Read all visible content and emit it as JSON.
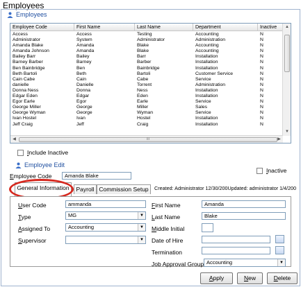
{
  "window": {
    "title": "Employees"
  },
  "employees_section": {
    "title": "Employees"
  },
  "grid": {
    "columns": [
      "Employee Code",
      "First Name",
      "Last Name",
      "Department",
      "Inactive"
    ],
    "rows": [
      [
        "Access",
        "Access",
        "Testing",
        "Accounting",
        "N"
      ],
      [
        "Administrator",
        "System",
        "Administrator",
        "Administration",
        "N"
      ],
      [
        "Amanda Blake",
        "Amanda",
        "Blake",
        "Accounting",
        "N"
      ],
      [
        "Amanda Johnson",
        "Amanda",
        "Blake",
        "Accounting",
        "N"
      ],
      [
        "Bailey Barr",
        "Bailey",
        "Barr",
        "Installation",
        "N"
      ],
      [
        "Barney Barber",
        "Barney",
        "Barber",
        "Installation",
        "N"
      ],
      [
        "Ben Bainbridge",
        "Ben",
        "Bainbridge",
        "Installation",
        "N"
      ],
      [
        "Beth Bartoli",
        "Beth",
        "Bartoli",
        "Customer Service",
        "N"
      ],
      [
        "Cain Cabe",
        "Cain",
        "Cabe",
        "Service",
        "N"
      ],
      [
        "danielle",
        "Danielle",
        "Torrent",
        "Administration",
        "N"
      ],
      [
        "Donna Ness",
        "Donna",
        "Ness",
        "Installation",
        "N"
      ],
      [
        "Edgar Eden",
        "Edgar",
        "Eden",
        "Installation",
        "N"
      ],
      [
        "Egor Earle",
        "Egor",
        "Earle",
        "Service",
        "N"
      ],
      [
        "George Miller",
        "George",
        "Miller",
        "Sales",
        "N"
      ],
      [
        "George Wyman",
        "George",
        "Wyman",
        "Service",
        "N"
      ],
      [
        "Ivan Hostel",
        "Ivan",
        "Hostel",
        "Installation",
        "N"
      ],
      [
        "Jeff Craig",
        "Jeff",
        "Craig",
        "Installation",
        "N"
      ]
    ]
  },
  "include_inactive": {
    "label": "Include Inactive",
    "checked": false
  },
  "employee_edit": {
    "title": "Employee Edit",
    "employee_code_label": "Employee Code",
    "employee_code_value": "Amanda Blake",
    "inactive_label": "Inactive",
    "inactive_checked": false
  },
  "tabs": [
    {
      "label": "General Information",
      "active": true
    },
    {
      "label": "Payroll",
      "active": false
    },
    {
      "label": "Commission Setup",
      "active": false
    }
  ],
  "audit_text": "Created: Administrator 12/30/200Updated: administrator 1/4/200",
  "form": {
    "user_code_label": "User Code",
    "user_code_value": "ammanda",
    "type_label": "Type",
    "type_value": "MG",
    "assigned_to_label": "Assigned To",
    "assigned_to_value": "Accounting",
    "supervisor_label": "Supervisor",
    "supervisor_value": "",
    "first_name_label": "First Name",
    "first_name_value": "Amanda",
    "last_name_label": "Last Name",
    "last_name_value": "Blake",
    "middle_initial_label": "Middle Initial",
    "middle_initial_value": "",
    "date_of_hire_label": "Date of Hire",
    "date_of_hire_value": "",
    "termination_label": "Termination",
    "termination_value": "",
    "job_approval_group_label": "Job Approval Group",
    "job_approval_group_value": "Accounting"
  },
  "buttons": {
    "apply": "Apply",
    "new": "New",
    "delete": "Delete"
  },
  "icons": {
    "section": "people-icon",
    "scroll_up": "▲",
    "scroll_down": "▼",
    "scroll_left": "◀",
    "scroll_right": "▶",
    "dropdown": "▼",
    "thumb_grip": "III"
  },
  "colors": {
    "accent": "#1f4fa0",
    "highlight_ring": "#d6281e"
  }
}
